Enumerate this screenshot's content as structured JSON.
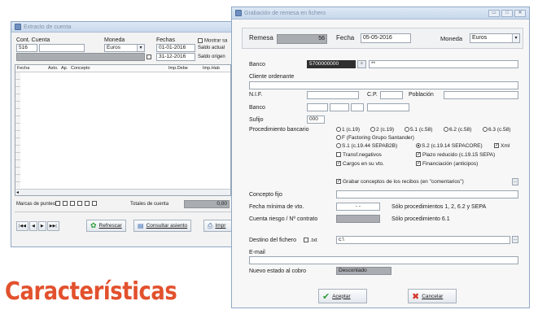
{
  "background_window": {
    "title": "Extracto de cuenta",
    "cont_cuenta_label": "Cont. Cuenta",
    "cont_value": "516",
    "moneda_label": "Moneda",
    "moneda_value": "Euros",
    "fechas_label": "Fechas",
    "fecha_desde": "01-01-2016",
    "fecha_hasta": "31-12-2016",
    "mostrar_label": "Mostrar sa",
    "saldo_actual_label": "Saldo actual",
    "saldo_origen_label": "Saldo origen",
    "columns": [
      "Fecha",
      "Asto.",
      "Ap.",
      "Concepto",
      "Imp.Debe",
      "Imp.Hab"
    ],
    "marcas_label": "Marcas de punteo",
    "totales_label": "Totales de cuenta",
    "totales_value": "0,00",
    "nav_buttons": [
      "|◀◀",
      "◀",
      "▶",
      "▶▶|"
    ],
    "refrescar_label": "Refrescar",
    "consultar_label": "Consultar asiento",
    "imprimir_label": "Impr"
  },
  "dialog": {
    "title": "Grabación de remesa en fichero",
    "remesa_label": "Remesa",
    "remesa_value": "56",
    "fecha_label": "Fecha",
    "fecha_value": "05-05-2016",
    "moneda_label": "Moneda",
    "moneda_value": "Euros",
    "banco_label": "Banco",
    "banco_value": "5700000000",
    "banco_extra": "**",
    "cliente_label": "Cliente ordenante",
    "nif_label": "N.I.F.",
    "cp_label": "C.P.",
    "poblacion_label": "Población",
    "banco2_label": "Banco",
    "sufijo_label": "Sufijo",
    "sufijo_value": "000",
    "procedimiento_label": "Procedimiento bancario",
    "proc_options": [
      {
        "label": "1 (c.19)",
        "selected": false
      },
      {
        "label": "2 (c.19)",
        "selected": false
      },
      {
        "label": "5.1 (c.58)",
        "selected": false
      },
      {
        "label": "6.2 (c.58)",
        "selected": false
      },
      {
        "label": "6.3 (c.58)",
        "selected": false
      },
      {
        "label": "F (Factoring Grupo Santander)",
        "selected": false
      },
      {
        "label": "S.1 (c.19.44 SEPAB2B)",
        "selected": false
      },
      {
        "label": "S.2 (c.19.14 SEPACORE)",
        "selected": true
      }
    ],
    "xml_label": "Xml",
    "transf_negativos_label": "Transf.negativos",
    "plazo_reducido_label": "Plazo reducido (c.19.15 SEPA)",
    "cargos_label": "Cargos en su vto.",
    "financiacion_label": "Financiación (anticipos)",
    "grabar_conceptos_label": "Grabar conceptos de los recibos (en \"comentarios\")",
    "concepto_fijo_label": "Concepto fijo",
    "fecha_minima_label": "Fecha mínima de vto.",
    "fecha_minima_value": "-  -",
    "solo_proc_label": "Sólo procedimientos 1, 2, 6.2 y SEPA",
    "cuenta_riesgo_label": "Cuenta riesgo / Nº contrato",
    "solo_proc61_label": "Sólo procedimiento 6.1",
    "destino_label": "Destino del fichero",
    "txt_label": ".txt",
    "destino_value": "c:\\",
    "email_label": "E-mail",
    "nuevo_estado_label": "Nuevo estado al cobro",
    "nuevo_estado_value": "Descontado",
    "aceptar_label": "Aceptar",
    "cancelar_label": "Cancelar"
  },
  "caption": "Características",
  "colors": {
    "caption": "#e2512d",
    "title_bar": "#c8d8eb",
    "accept_icon": "#2e9c3a",
    "cancel_icon": "#d6342a"
  }
}
